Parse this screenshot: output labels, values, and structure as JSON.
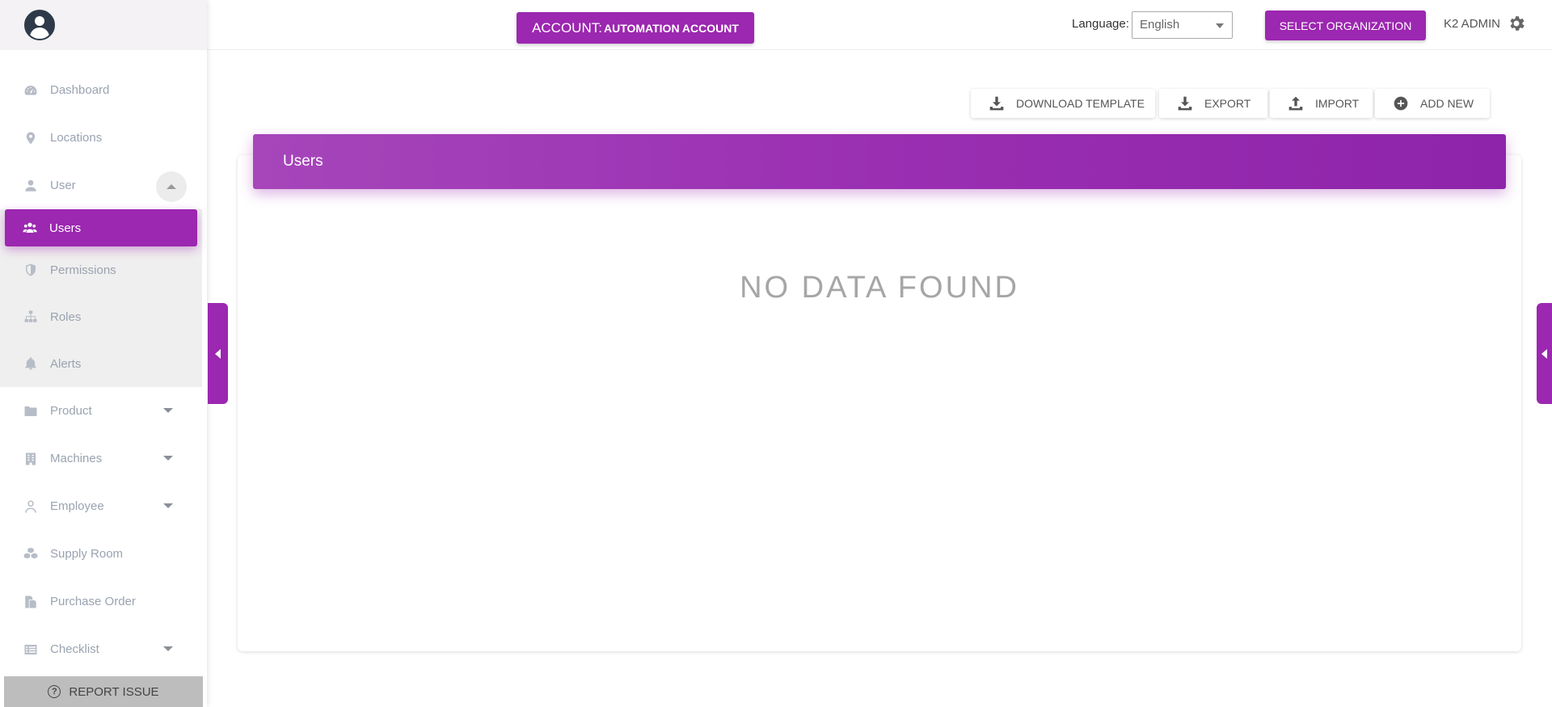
{
  "sidebar": {
    "items": [
      {
        "label": "Dashboard",
        "icon": "dashboard-icon"
      },
      {
        "label": "Locations",
        "icon": "location-pin-icon"
      },
      {
        "label": "User",
        "icon": "user-icon",
        "expanded": true
      },
      {
        "label": "Users",
        "icon": "users-group-icon",
        "active": true
      },
      {
        "label": "Permissions",
        "icon": "shield-icon"
      },
      {
        "label": "Roles",
        "icon": "sitemap-icon"
      },
      {
        "label": "Alerts",
        "icon": "bell-icon"
      },
      {
        "label": "Product",
        "icon": "folder-icon",
        "has_dropdown": true
      },
      {
        "label": "Machines",
        "icon": "building-icon",
        "has_dropdown": true
      },
      {
        "label": "Employee",
        "icon": "user-outline-icon",
        "has_dropdown": true
      },
      {
        "label": "Supply Room",
        "icon": "boxes-icon"
      },
      {
        "label": "Purchase Order",
        "icon": "document-icon"
      },
      {
        "label": "Checklist",
        "icon": "list-icon",
        "has_dropdown": true
      }
    ],
    "report_issue": "REPORT ISSUE"
  },
  "topbar": {
    "account_prefix": "ACCOUNT:",
    "account_name": "AUTOMATION ACCOUNT",
    "language_label": "Language:",
    "language_value": "English",
    "select_org": "SELECT ORGANIZATION",
    "admin_name": "K2 ADMIN"
  },
  "actions": {
    "download_template": "DOWNLOAD TEMPLATE",
    "export": "EXPORT",
    "import": "IMPORT",
    "add_new": "ADD NEW"
  },
  "card": {
    "title": "Users",
    "empty_message": "NO DATA FOUND"
  },
  "colors": {
    "accent": "#9c27b0"
  }
}
